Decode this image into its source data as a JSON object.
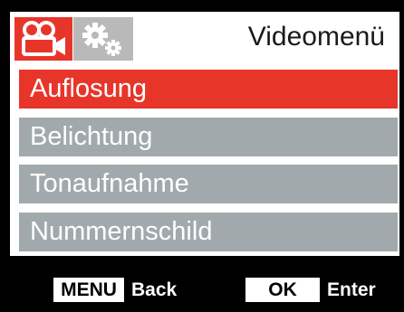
{
  "header": {
    "title": "Videomenü",
    "tabs": [
      {
        "icon": "video-camera-icon",
        "active": true
      },
      {
        "icon": "gears-icon",
        "active": false
      }
    ]
  },
  "menu": {
    "items": [
      {
        "label": "Auflosung",
        "selected": true
      },
      {
        "label": "Belichtung",
        "selected": false
      },
      {
        "label": "Tonaufnahme",
        "selected": false
      },
      {
        "label": "Nummernschild",
        "selected": false
      }
    ]
  },
  "footer": {
    "menu_key": "MENU",
    "menu_action": "Back",
    "ok_key": "OK",
    "ok_action": "Enter"
  },
  "colors": {
    "accent": "#e8352a",
    "item_bg": "#a1a9ad",
    "tab_inactive": "#b9b9b9",
    "background": "#000000",
    "panel": "#ffffff"
  }
}
